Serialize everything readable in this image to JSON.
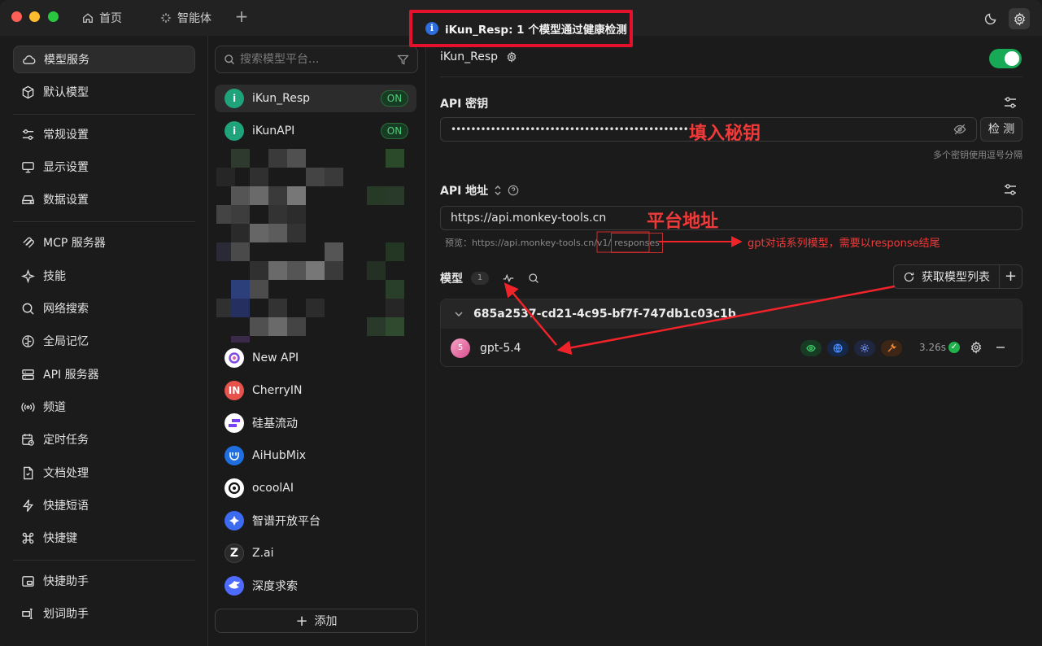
{
  "titlebar": {
    "tabs": [
      {
        "label": "首页",
        "icon": "home-icon"
      },
      {
        "label": "智能体",
        "icon": "sparkle-icon"
      }
    ],
    "toast_text": "iKun_Resp: 1 个模型通过健康检测"
  },
  "nav": {
    "items": [
      {
        "label": "模型服务",
        "icon": "cloud-icon"
      },
      {
        "label": "默认模型",
        "icon": "cube-icon"
      },
      {
        "label": "常规设置",
        "icon": "sliders-icon"
      },
      {
        "label": "显示设置",
        "icon": "monitor-icon"
      },
      {
        "label": "数据设置",
        "icon": "drive-icon"
      },
      {
        "label": "MCP 服务器",
        "icon": "mcp-icon"
      },
      {
        "label": "技能",
        "icon": "sparkle-icon"
      },
      {
        "label": "网络搜索",
        "icon": "search-icon"
      },
      {
        "label": "全局记忆",
        "icon": "brain-icon"
      },
      {
        "label": "API 服务器",
        "icon": "server-icon"
      },
      {
        "label": "频道",
        "icon": "radio-icon"
      },
      {
        "label": "定时任务",
        "icon": "calendar-clock-icon"
      },
      {
        "label": "文档处理",
        "icon": "file-icon"
      },
      {
        "label": "快捷短语",
        "icon": "bolt-icon"
      },
      {
        "label": "快捷键",
        "icon": "command-icon"
      },
      {
        "label": "快捷助手",
        "icon": "window-icon"
      },
      {
        "label": "划词助手",
        "icon": "text-cursor-icon"
      }
    ]
  },
  "providers": {
    "search_placeholder": "搜索模型平台...",
    "on_label": "ON",
    "items": [
      {
        "name": "iKun_Resp",
        "avatar": "i",
        "color": "#1fa37a",
        "enabled": true
      },
      {
        "name": "iKunAPI",
        "avatar": "i",
        "color": "#1fa37a",
        "enabled": true
      },
      {
        "name": "New API",
        "avatar": "",
        "color": "#6b4fd8"
      },
      {
        "name": "CherryIN",
        "avatar": "IN",
        "color": "#e8524d"
      },
      {
        "name": "硅基流动",
        "avatar": "",
        "color": "#7b3ff2"
      },
      {
        "name": "AiHubMix",
        "avatar": "",
        "color": "#1f6fe0"
      },
      {
        "name": "ocoolAI",
        "avatar": "",
        "color": "#111111"
      },
      {
        "name": "智谱开放平台",
        "avatar": "",
        "color": "#3d6bf0"
      },
      {
        "name": "Z.ai",
        "avatar": "Z",
        "color": "#2a2a2a"
      },
      {
        "name": "深度求索",
        "avatar": "",
        "color": "#4d6bfe"
      }
    ],
    "add_label": "添加"
  },
  "main": {
    "provider_name": "iKun_Resp",
    "api_key_label": "API 密钥",
    "api_key_value": "••••••••••••••••••••••••••••••••••••••••••••••••",
    "check_label": "检 测",
    "key_hint": "多个密钥使用逗号分隔",
    "api_url_label": "API 地址",
    "api_url_value": "https://api.monkey-tools.cn",
    "preview_label": "预览：",
    "preview_url": "https://api.monkey-tools.cn/v1/",
    "preview_suffix": "responses",
    "models_label": "模型",
    "models_count": "1",
    "fetch_label": "获取模型列表",
    "group_name": "685a2537-cd21-4c95-bf7f-747db1c03c1b",
    "model_name": "gpt-5.4",
    "model_avatar": "5",
    "latency": "3.26s"
  },
  "annotations": {
    "fill_key": "填入秘钥",
    "platform_url": "平台地址",
    "gpt_note": "gpt对话系列模型，需要以response结尾"
  },
  "colors": {
    "accent_green": "#18a957",
    "annotation_red": "#f03a3a",
    "toast_border": "#e5102c"
  }
}
